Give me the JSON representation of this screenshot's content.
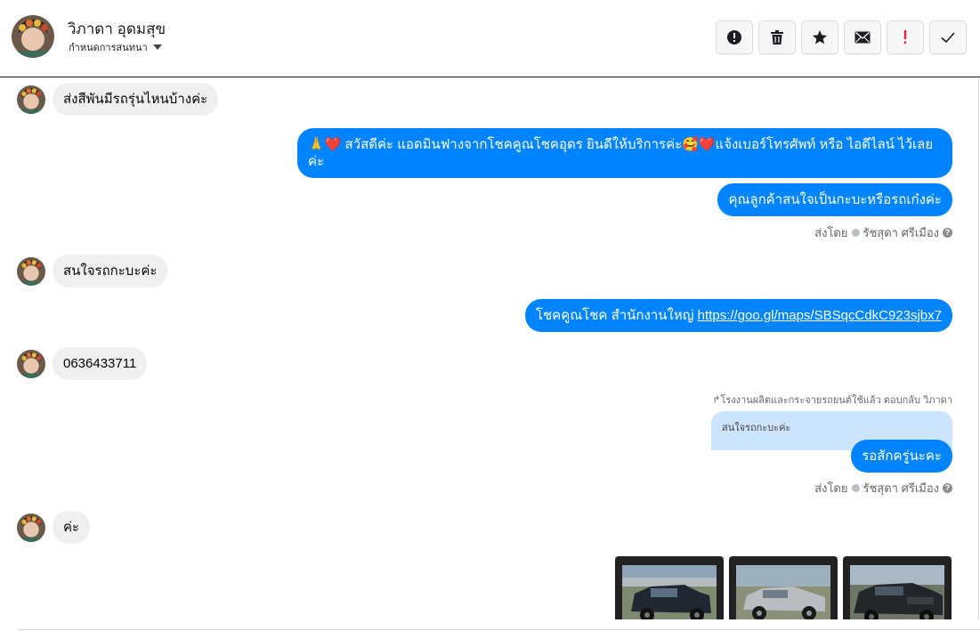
{
  "header": {
    "contact_name": "วิภาดา อุดมสุข",
    "conversation_settings": "กำหนดการสนทนา",
    "actions": [
      {
        "name": "mark-spam",
        "icon": "alert-circle-icon"
      },
      {
        "name": "delete",
        "icon": "trash-icon"
      },
      {
        "name": "star",
        "icon": "star-icon"
      },
      {
        "name": "mark-unread",
        "icon": "envelope-icon"
      },
      {
        "name": "follow-up",
        "icon": "exclamation-icon"
      },
      {
        "name": "done",
        "icon": "checkmark-icon"
      }
    ]
  },
  "messages": [
    {
      "dir": "in",
      "text": "ส่งสีพันมีรถรุ่นไหนบ้างค่ะ"
    },
    {
      "dir": "out",
      "text": "🙏❤️ สวัสดีค่ะ แอดมินฟางจากโชคคูณโชคอุดร ยินดีให้บริการค่ะ🥰❤️แจ้งเบอร์โทรศัพท์ หรือ ไอดีไลน์  ไว้เลยค่ะ"
    },
    {
      "dir": "out",
      "text": "คุณลูกค้าสนใจเป็นกะบะหรือรถเก๋งค่ะ"
    },
    {
      "dir": "in",
      "text": "สนใจรถกะบะค่ะ"
    },
    {
      "dir": "out",
      "text_prefix": "โชคคูณโชค สำนักงานใหญ่ ",
      "link": "https://goo.gl/maps/SBSqcCdkC923sjbx7"
    },
    {
      "dir": "in",
      "text": "0636433711"
    },
    {
      "dir": "out",
      "text": "รอสักครู่นะคะ"
    },
    {
      "dir": "in",
      "text": "ค่ะ"
    }
  ],
  "sent_by": {
    "prefix": "ส่งโดย",
    "name": "รัชสุดา ศรีเมือง"
  },
  "reply_context": {
    "note": "โรงงานผลิตและกระจายรถยนต์ใช้แล้ว ตอบกลับ วิภาดา",
    "quoted_text": "สนใจรถกะบะค่ะ"
  },
  "photos": [
    {
      "name": "black-pickup-truck",
      "body_color": "#1f2733"
    },
    {
      "name": "silver-pickup-truck",
      "body_color": "#b9bcc0"
    },
    {
      "name": "black-pickup-truck-2",
      "body_color": "#23262b"
    }
  ],
  "colors": {
    "outgoing_bubble": "#0084ff",
    "incoming_bubble": "#f0f0f0",
    "follow_up_red": "#e41e3f"
  }
}
